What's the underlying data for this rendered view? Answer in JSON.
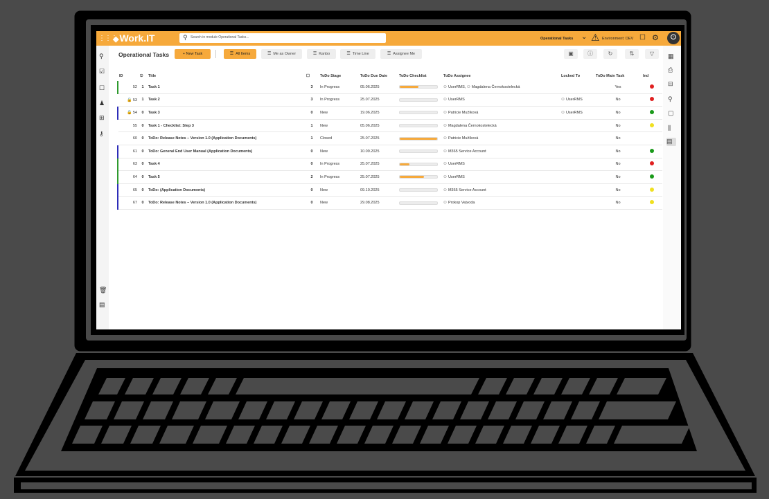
{
  "app": {
    "brand": "Work.IT",
    "search_placeholder": "Search in module Operational Tasks...",
    "module_name": "Operational Tasks",
    "environment": "Environment: DEV"
  },
  "page": {
    "title": "Operational Tasks",
    "new_task": "+ New Task",
    "views": [
      "All Items",
      "Me as Owner",
      "Kanbo",
      "Time Line",
      "Assignee Me"
    ]
  },
  "columns": {
    "id": "ID",
    "title": "Title",
    "stage": "ToDo Stage",
    "due": "ToDo Due Date",
    "checklist": "ToDo Checklist",
    "assignee": "ToDo Assignee",
    "locked": "Locked To",
    "main": "ToDo Main Task",
    "ind": "Ind"
  },
  "rows": [
    {
      "id": "52",
      "lock": "",
      "att": "1",
      "title": "Task 1",
      "comments": "3",
      "stage": "In Progress",
      "due": "05.06.2025",
      "progress": 0.5,
      "assignee": "UserRMS, ",
      "assignee2": "Magdalena Černokostelecká",
      "locked": "",
      "main": "Yes",
      "ind": "#e02020",
      "bar": "#2e9a2e"
    },
    {
      "id": "53",
      "lock": "red",
      "att": "1",
      "title": "Task 2",
      "comments": "3",
      "stage": "In Progress",
      "due": "25.07.2025",
      "progress": 0.0,
      "assignee": "UserRMS",
      "assignee2": "",
      "locked": "UserRMS",
      "main": "No",
      "ind": "#e02020",
      "bar": ""
    },
    {
      "id": "54",
      "lock": "pink",
      "att": "0",
      "title": "Task 3",
      "comments": "0",
      "stage": "New",
      "due": "19.06.2025",
      "progress": 0.0,
      "assignee": "Patricie Mužíková",
      "assignee2": "",
      "locked": "UserRMS",
      "main": "No",
      "ind": "#1a9a1a",
      "bar": "#2d2db8"
    },
    {
      "id": "55",
      "lock": "",
      "att": "0",
      "title": "Task 1 - Checklist: Step 3",
      "comments": "1",
      "stage": "New",
      "due": "05.06.2025",
      "progress": 0.0,
      "assignee": "Magdalena Černokostelecká",
      "assignee2": "",
      "locked": "",
      "main": "No",
      "ind": "#f0e020",
      "bar": ""
    },
    {
      "id": "60",
      "lock": "",
      "att": "0",
      "title": "ToDo: Release Notes – Version 1.0 (Application Documents)",
      "comments": "1",
      "stage": "Closed",
      "due": "25.07.2025",
      "progress": 1.0,
      "assignee": "Patricie Mužíková",
      "assignee2": "",
      "locked": "",
      "main": "No",
      "ind": "",
      "bar": ""
    },
    {
      "id": "61",
      "lock": "",
      "att": "0",
      "title": "ToDo: General End User Manual (Application Documents)",
      "comments": "0",
      "stage": "New",
      "due": "10.09.2025",
      "progress": 0.0,
      "assignee": "M365 Service Account",
      "assignee2": "",
      "locked": "",
      "main": "No",
      "ind": "#1a9a1a",
      "bar": "#2d2db8"
    },
    {
      "id": "63",
      "lock": "",
      "att": "0",
      "title": "Task 4",
      "comments": "0",
      "stage": "In Progress",
      "due": "25.07.2025",
      "progress": 0.25,
      "assignee": "UserRMS",
      "assignee2": "",
      "locked": "",
      "main": "No",
      "ind": "#e02020",
      "bar": "#2e9a2e"
    },
    {
      "id": "64",
      "lock": "",
      "att": "0",
      "title": "Task 5",
      "comments": "2",
      "stage": "In Progress",
      "due": "25.07.2025",
      "progress": 0.65,
      "assignee": "UserRMS",
      "assignee2": "",
      "locked": "",
      "main": "No",
      "ind": "#1a9a1a",
      "bar": "#2e9a2e"
    },
    {
      "id": "65",
      "lock": "",
      "att": "0",
      "title": "ToDo: (Application Documents)",
      "comments": "0",
      "stage": "New",
      "due": "09.10.2025",
      "progress": 0.0,
      "assignee": "M365 Service Account",
      "assignee2": "",
      "locked": "",
      "main": "No",
      "ind": "#f0e020",
      "bar": "#2d2db8"
    },
    {
      "id": "67",
      "lock": "",
      "att": "0",
      "title": "ToDo: Release Notes – Version 1.0 (Application Documents)",
      "comments": "0",
      "stage": "New",
      "due": "29.08.2025",
      "progress": 0.0,
      "assignee": "Prokop Vejvoda",
      "assignee2": "",
      "locked": "",
      "main": "No",
      "ind": "#f0e020",
      "bar": "#2d2db8"
    }
  ]
}
